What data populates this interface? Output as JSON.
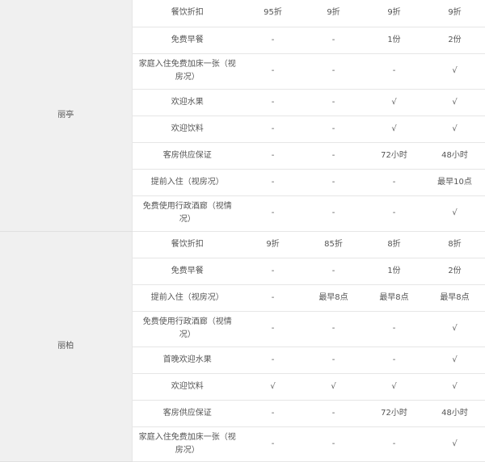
{
  "groups": [
    {
      "name": "丽亭",
      "rows": [
        {
          "benefit": "餐饮折扣",
          "values": [
            "95折",
            "9折",
            "9折",
            "9折"
          ]
        },
        {
          "benefit": "免费早餐",
          "values": [
            "-",
            "-",
            "1份",
            "2份"
          ]
        },
        {
          "benefit": "家庭入住免费加床一张（视房况）",
          "values": [
            "-",
            "-",
            "-",
            "√"
          ]
        },
        {
          "benefit": "欢迎水果",
          "values": [
            "-",
            "-",
            "√",
            "√"
          ]
        },
        {
          "benefit": "欢迎饮料",
          "values": [
            "-",
            "-",
            "√",
            "√"
          ]
        },
        {
          "benefit": "客房供应保证",
          "values": [
            "-",
            "-",
            "72小时",
            "48小时"
          ]
        },
        {
          "benefit": "提前入住（视房况）",
          "values": [
            "-",
            "-",
            "-",
            "最早10点"
          ]
        },
        {
          "benefit": "免费使用行政酒廊（视情况）",
          "values": [
            "-",
            "-",
            "-",
            "√"
          ]
        }
      ]
    },
    {
      "name": "丽柏",
      "rows": [
        {
          "benefit": "餐饮折扣",
          "values": [
            "9折",
            "85折",
            "8折",
            "8折"
          ]
        },
        {
          "benefit": "免费早餐",
          "values": [
            "-",
            "-",
            "1份",
            "2份"
          ]
        },
        {
          "benefit": "提前入住（视房况）",
          "values": [
            "-",
            "最早8点",
            "最早8点",
            "最早8点"
          ]
        },
        {
          "benefit": "免费使用行政酒廊（视情况）",
          "values": [
            "-",
            "-",
            "-",
            "√"
          ]
        },
        {
          "benefit": "首晚欢迎水果",
          "values": [
            "-",
            "-",
            "-",
            "√"
          ]
        },
        {
          "benefit": "欢迎饮料",
          "values": [
            "√",
            "√",
            "√",
            "√"
          ]
        },
        {
          "benefit": "客房供应保证",
          "values": [
            "-",
            "-",
            "72小时",
            "48小时"
          ]
        },
        {
          "benefit": "家庭入住免费加床一张（视房况）",
          "values": [
            "-",
            "-",
            "-",
            "√"
          ]
        }
      ]
    }
  ]
}
